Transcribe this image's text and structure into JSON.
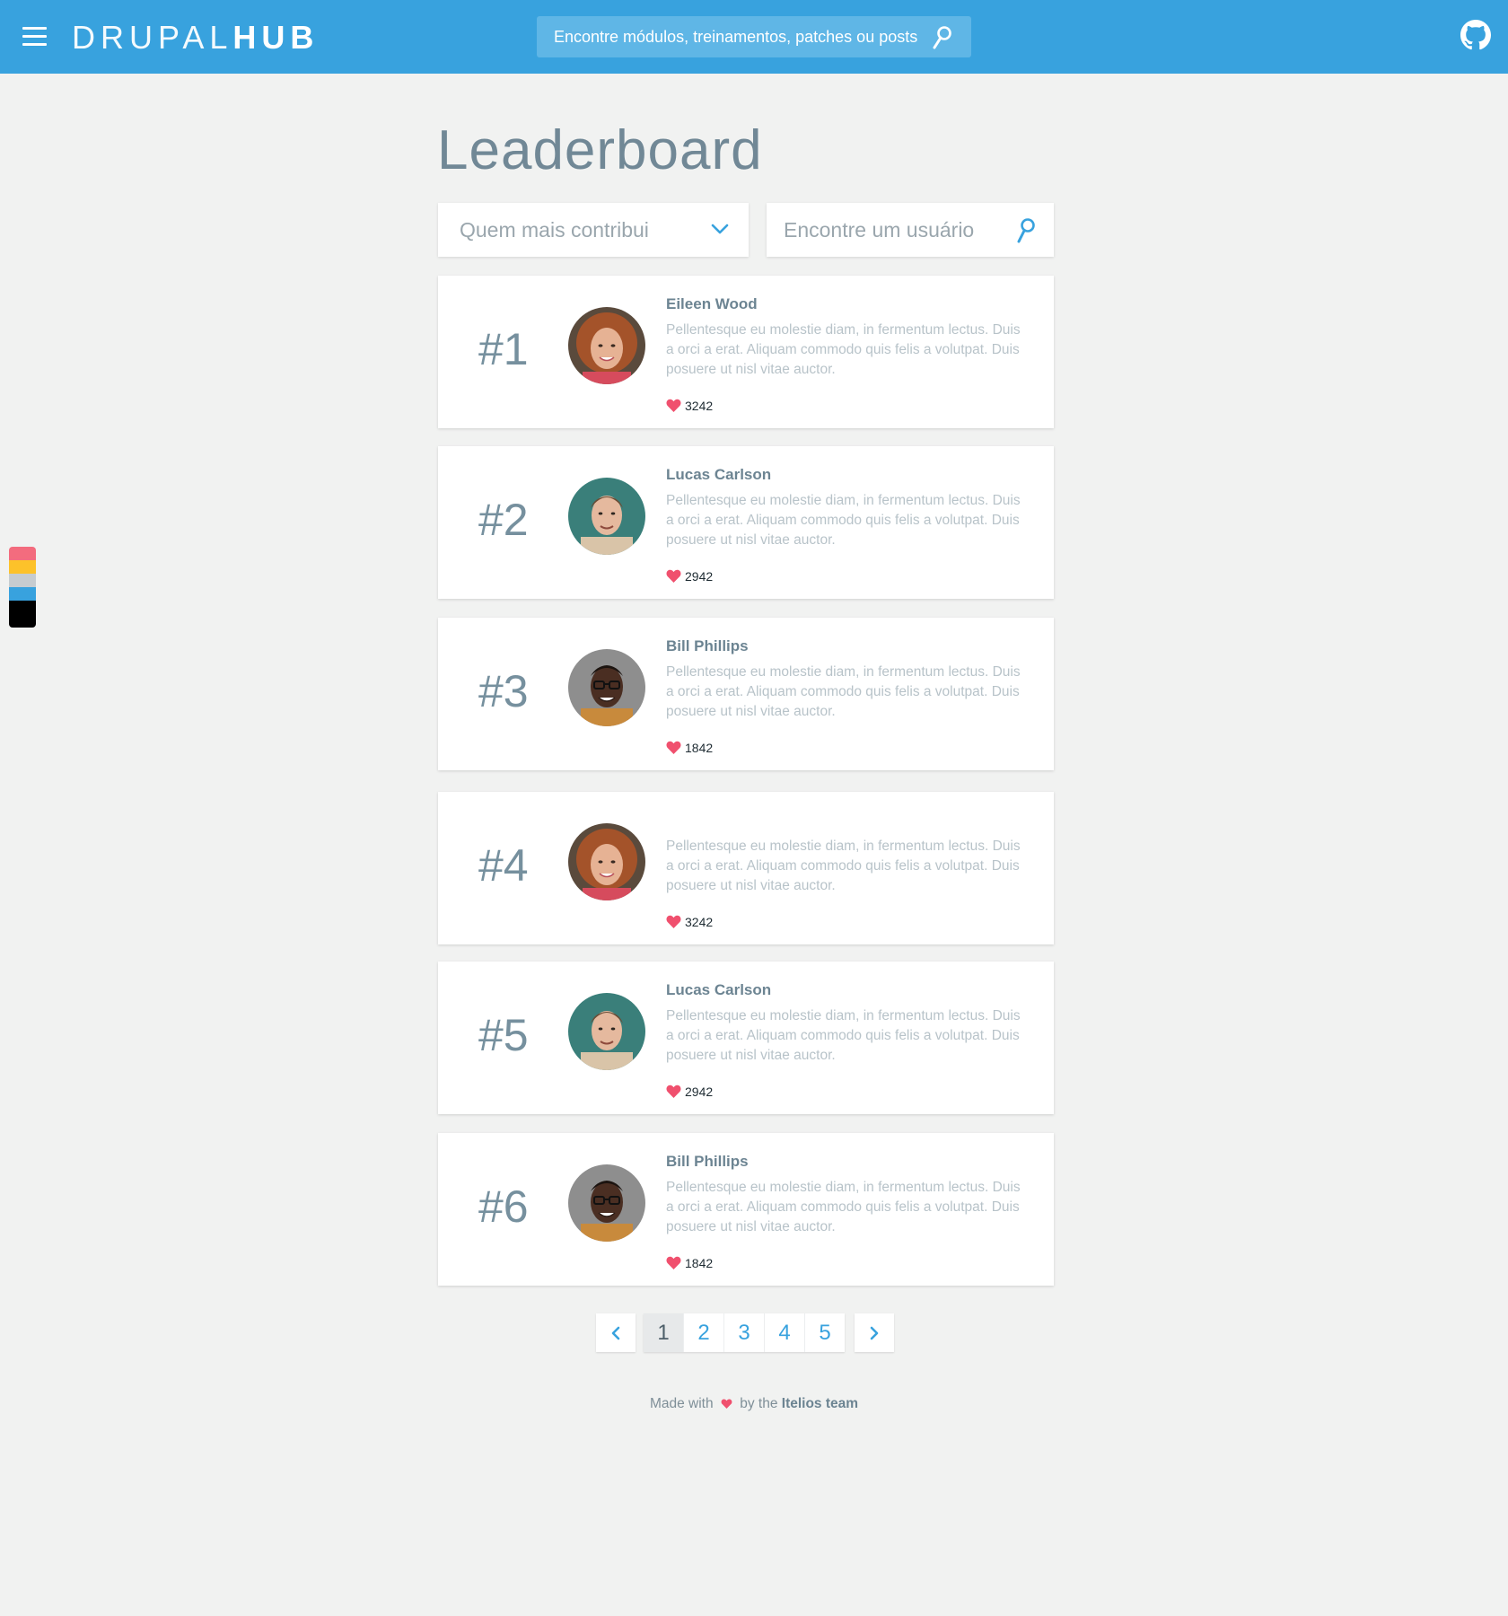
{
  "header": {
    "logo_light": "DRUPAL",
    "logo_bold": "HUB",
    "search_placeholder": "Encontre módulos, treinamentos, patches ou posts",
    "color": "#38a2de"
  },
  "palette": [
    "#f36c7e",
    "#fdc22a",
    "#c6ccd0",
    "#38a2de",
    "#000000"
  ],
  "main": {
    "title": "Leaderboard",
    "filter_value": "Quem mais contribui",
    "user_search_placeholder": "Encontre um usuário"
  },
  "leaderboard": [
    {
      "rank": "#1",
      "name": "Eileen Wood",
      "description": "Pellentesque eu molestie diam, in fermentum lectus. Duis a orci a erat. Aliquam commodo quis felis a volutpat. Duis posuere ut nisl vitae auctor.",
      "likes": "3242",
      "avatar": "woman-avatar"
    },
    {
      "rank": "#2",
      "name": "Lucas Carlson",
      "description": "Pellentesque eu molestie diam, in fermentum lectus. Duis a orci a erat. Aliquam commodo quis felis a volutpat. Duis posuere ut nisl vitae auctor.",
      "likes": "2942",
      "avatar": "man-avatar"
    },
    {
      "rank": "#3",
      "name": "Bill Phillips",
      "description": "Pellentesque eu molestie diam, in fermentum lectus. Duis a orci a erat. Aliquam commodo quis felis a volutpat. Duis posuere ut nisl vitae auctor.",
      "likes": "1842",
      "avatar": "man-glasses-avatar"
    },
    {
      "rank": "#4",
      "name": "",
      "description": "Pellentesque eu molestie diam, in fermentum lectus. Duis a orci a erat. Aliquam commodo quis felis a volutpat. Duis posuere ut nisl vitae auctor.",
      "likes": "3242",
      "avatar": "woman-avatar"
    },
    {
      "rank": "#5",
      "name": "Lucas Carlson",
      "description": "Pellentesque eu molestie diam, in fermentum lectus. Duis a orci a erat. Aliquam commodo quis felis a volutpat. Duis posuere ut nisl vitae auctor.",
      "likes": "2942",
      "avatar": "man-avatar"
    },
    {
      "rank": "#6",
      "name": "Bill Phillips",
      "description": "Pellentesque eu molestie diam, in fermentum lectus. Duis a orci a erat. Aliquam commodo quis felis a volutpat. Duis posuere ut nisl vitae auctor.",
      "likes": "1842",
      "avatar": "man-glasses-avatar"
    }
  ],
  "pagination": {
    "pages": [
      "1",
      "2",
      "3",
      "4",
      "5"
    ],
    "current": "1",
    "prev_icon": "chevron-left-icon",
    "next_icon": "chevron-right-icon"
  },
  "footer": {
    "prefix": "Made with",
    "middle": "by the",
    "team": "Itelios team",
    "heart_color": "#f0506e"
  }
}
